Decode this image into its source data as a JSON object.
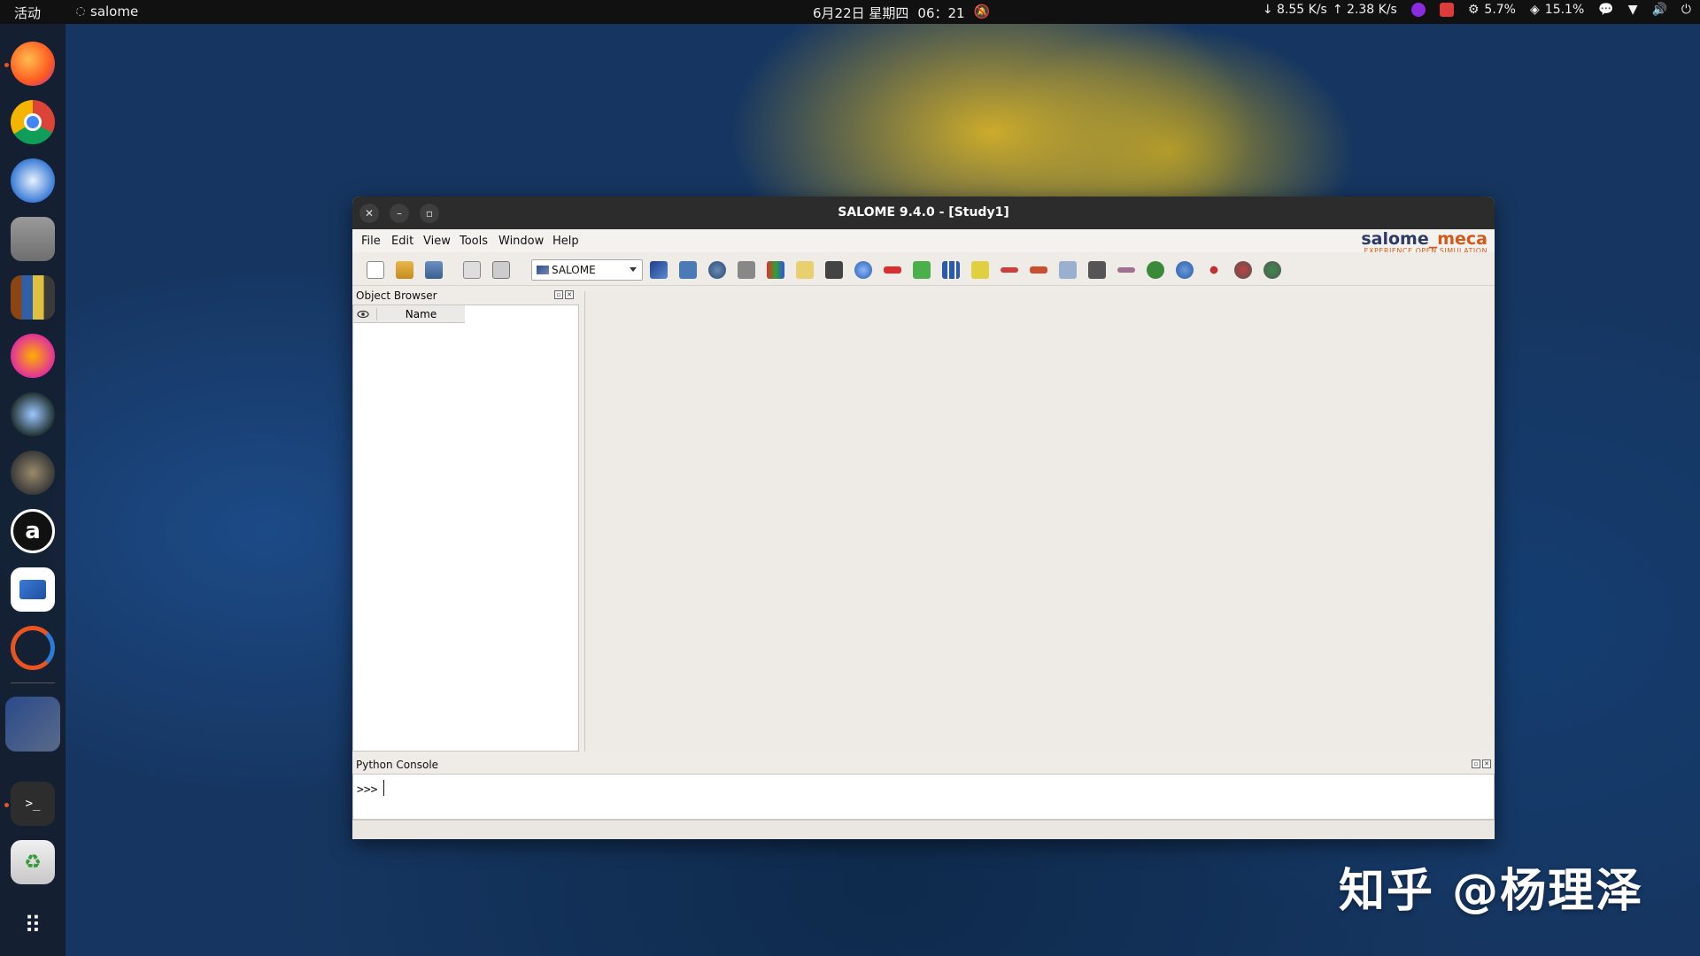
{
  "topbar": {
    "activities": "活动",
    "app_name": "salome",
    "date": "6月22日 星期四",
    "time": "06：21",
    "net_down": "↓ 8.55 K/s",
    "net_up": "↑ 2.38 K/s",
    "cpu": "5.7%",
    "mem": "15.1%"
  },
  "window": {
    "title": "SALOME 9.4.0 - [Study1]",
    "menu": [
      "File",
      "Edit",
      "View",
      "Tools",
      "Window",
      "Help"
    ],
    "logo_main": "salome",
    "logo_accent": "_meca",
    "logo_tagline": "EXPERIENCE OPEN SIMULATION",
    "module_combo": "SALOME",
    "object_browser_title": "Object Browser",
    "name_column": "Name",
    "python_console_title": "Python Console",
    "prompt": ">>>"
  },
  "colors": {
    "accent": "#d15a1a",
    "logo_blue": "#2e3a66",
    "titlebar": "#2c2c2c"
  },
  "watermark": "知乎 @杨理泽"
}
